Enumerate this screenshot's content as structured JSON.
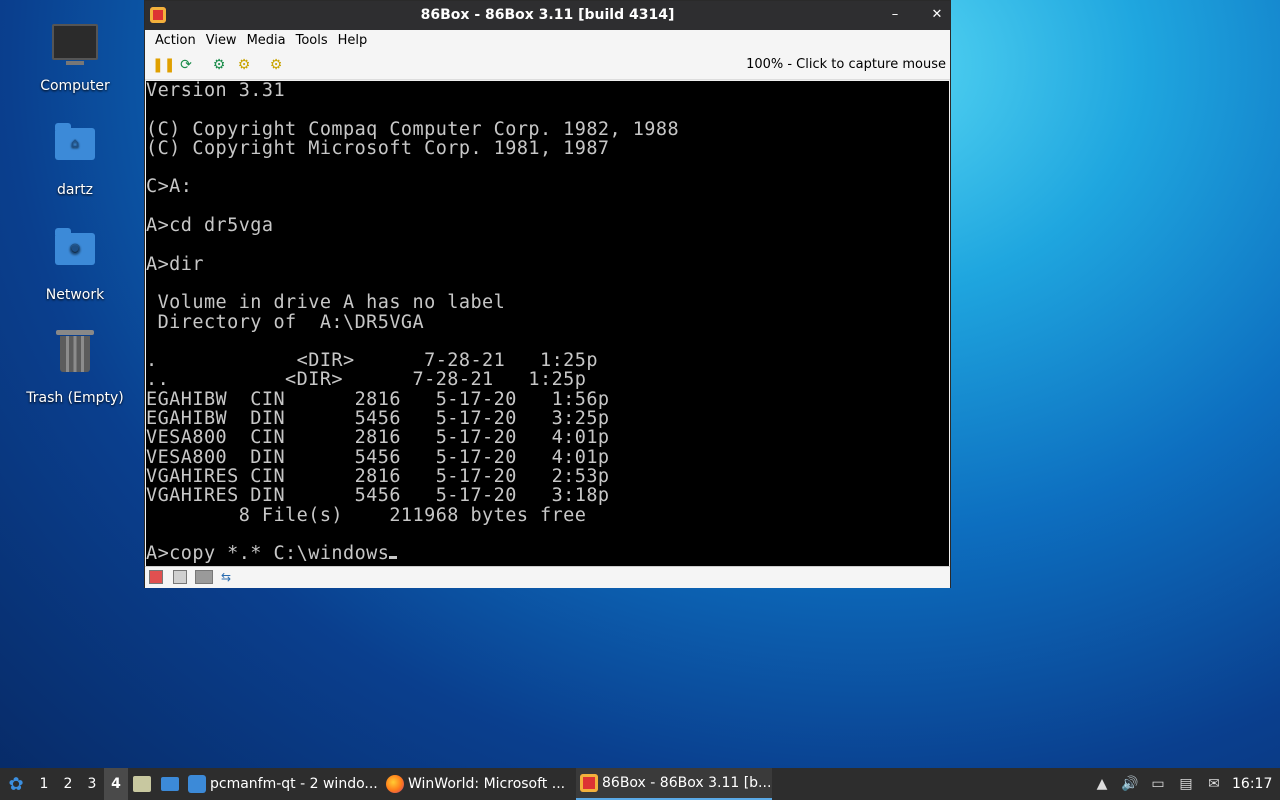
{
  "desktop": {
    "icons": [
      {
        "label": "Computer"
      },
      {
        "label": "dartz"
      },
      {
        "label": "Network"
      },
      {
        "label": "Trash (Empty)"
      }
    ]
  },
  "window": {
    "title": "86Box - 86Box 3.11 [build 4314]",
    "minimize_glyph": "–",
    "close_glyph": "✕",
    "menu": [
      "Action",
      "View",
      "Media",
      "Tools",
      "Help"
    ],
    "capture_status": "100% - Click to capture mouse",
    "console_lines": [
      "Version 3.31",
      "",
      "(C) Copyright Compaq Computer Corp. 1982, 1988",
      "(C) Copyright Microsoft Corp. 1981, 1987",
      "",
      "C>A:",
      "",
      "A>cd dr5vga",
      "",
      "A>dir",
      "",
      " Volume in drive A has no label",
      " Directory of  A:\\DR5VGA",
      "",
      ".            <DIR>      7-28-21   1:25p",
      "..          <DIR>      7-28-21   1:25p",
      "EGAHIBW  CIN      2816   5-17-20   1:56p",
      "EGAHIBW  DIN      5456   5-17-20   3:25p",
      "VESA800  CIN      2816   5-17-20   4:01p",
      "VESA800  DIN      5456   5-17-20   4:01p",
      "VGAHIRES CIN      2816   5-17-20   2:53p",
      "VGAHIRES DIN      5456   5-17-20   3:18p",
      "        8 File(s)    211968 bytes free",
      ""
    ],
    "prompt_line": "A>copy *.* C:\\windows"
  },
  "taskbar": {
    "workspaces": [
      "1",
      "2",
      "3",
      "4"
    ],
    "active_workspace": "4",
    "tasks": [
      {
        "label": "pcmanfm-qt - 2 windo..."
      },
      {
        "label": "WinWorld: Microsoft ..."
      },
      {
        "label": "86Box - 86Box 3.11 [b..."
      }
    ],
    "clock": "16:17"
  }
}
